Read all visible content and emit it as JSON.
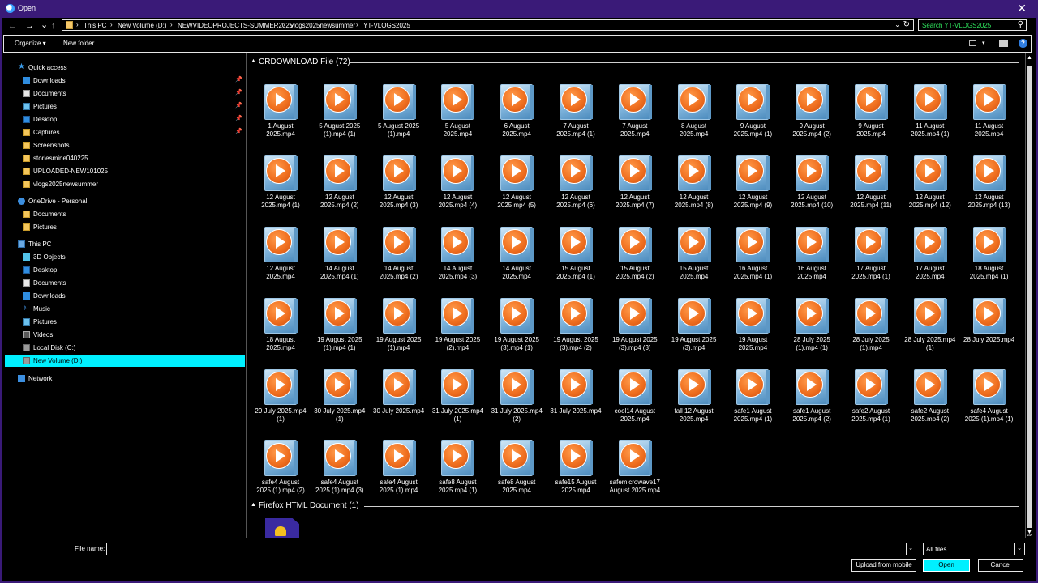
{
  "window": {
    "title": "Open",
    "close_glyph": "✕"
  },
  "nav_buttons": {
    "back": "←",
    "forward": "→",
    "recent": "⌄",
    "up": "↑"
  },
  "breadcrumb": [
    "This PC",
    "New Volume (D:)",
    "NEWVIDEOPROJECTS-SUMMER2025",
    "vlogs2025newsummer",
    "YT-VLOGS2025"
  ],
  "search": {
    "placeholder": "Search YT-VLOGS2025"
  },
  "toolbar": {
    "organize": "Organize ▾",
    "new_folder": "New folder",
    "help": "?"
  },
  "sidebar": {
    "quick_access": "Quick access",
    "quick_items": [
      {
        "label": "Downloads",
        "icon": "download-icon",
        "pinned": true
      },
      {
        "label": "Documents",
        "icon": "documents-icon",
        "pinned": true
      },
      {
        "label": "Pictures",
        "icon": "pictures-icon",
        "pinned": true
      },
      {
        "label": "Desktop",
        "icon": "desktop-icon",
        "pinned": true
      },
      {
        "label": "Captures",
        "icon": "folder-icon",
        "pinned": true
      },
      {
        "label": "Screenshots",
        "icon": "folder-icon",
        "pinned": false
      },
      {
        "label": "storiesmine040225",
        "icon": "folder-icon",
        "pinned": false
      },
      {
        "label": "UPLOADED-NEW101025",
        "icon": "folder-icon",
        "pinned": false
      },
      {
        "label": "vlogs2025newsummer",
        "icon": "folder-icon",
        "pinned": false
      }
    ],
    "onedrive": "OneDrive - Personal",
    "onedrive_items": [
      "Documents",
      "Pictures"
    ],
    "this_pc": "This PC",
    "pc_items": [
      "3D Objects",
      "Desktop",
      "Documents",
      "Downloads",
      "Music",
      "Pictures",
      "Videos",
      "Local Disk (C:)",
      "New Volume (D:)"
    ],
    "network": "Network",
    "selected": "New Volume (D:)"
  },
  "groups": {
    "crdownload": {
      "label": "CRDOWNLOAD File (72)"
    },
    "firefox": {
      "label": "Firefox HTML Document (1)"
    }
  },
  "files": [
    "1 August\n2025.mp4",
    "5 August 2025\n(1).mp4 (1)",
    "5 August 2025\n(1).mp4",
    "5 August\n2025.mp4",
    "6 August\n2025.mp4",
    "7 August\n2025.mp4 (1)",
    "7 August\n2025.mp4",
    "8 August\n2025.mp4",
    "9 August\n2025.mp4 (1)",
    "9 August\n2025.mp4 (2)",
    "9 August\n2025.mp4",
    "11 August\n2025.mp4 (1)",
    "11 August\n2025.mp4",
    "12 August\n2025.mp4 (1)",
    "12 August\n2025.mp4 (2)",
    "12 August\n2025.mp4 (3)",
    "12 August\n2025.mp4 (4)",
    "12 August\n2025.mp4 (5)",
    "12 August\n2025.mp4 (6)",
    "12 August\n2025.mp4 (7)",
    "12 August\n2025.mp4 (8)",
    "12 August\n2025.mp4 (9)",
    "12 August\n2025.mp4 (10)",
    "12 August\n2025.mp4 (11)",
    "12 August\n2025.mp4 (12)",
    "12 August\n2025.mp4 (13)",
    "12 August\n2025.mp4",
    "14 August\n2025.mp4 (1)",
    "14 August\n2025.mp4 (2)",
    "14 August\n2025.mp4 (3)",
    "14 August\n2025.mp4",
    "15 August\n2025.mp4 (1)",
    "15 August\n2025.mp4 (2)",
    "15 August\n2025.mp4",
    "16 August\n2025.mp4 (1)",
    "16 August\n2025.mp4",
    "17 August\n2025.mp4 (1)",
    "17 August\n2025.mp4",
    "18 August\n2025.mp4 (1)",
    "18 August\n2025.mp4",
    "19 August 2025\n(1).mp4 (1)",
    "19 August 2025\n(1).mp4",
    "19 August 2025\n(2).mp4",
    "19 August 2025\n(3).mp4 (1)",
    "19 August 2025\n(3).mp4 (2)",
    "19 August 2025\n(3).mp4 (3)",
    "19 August 2025\n(3).mp4",
    "19 August\n2025.mp4",
    "28 July 2025\n(1).mp4 (1)",
    "28 July 2025\n(1).mp4",
    "28 July 2025.mp4\n(1)",
    "28 July 2025.mp4",
    "29 July 2025.mp4\n(1)",
    "30 July 2025.mp4\n(1)",
    "30 July 2025.mp4",
    "31 July 2025.mp4\n(1)",
    "31 July 2025.mp4\n(2)",
    "31 July 2025.mp4",
    "cool14 August\n2025.mp4",
    "fall 12 August\n2025.mp4",
    "safe1 August\n2025.mp4 (1)",
    "safe1 August\n2025.mp4 (2)",
    "safe2 August\n2025.mp4 (1)",
    "safe2 August\n2025.mp4 (2)",
    "safe4 August\n2025 (1).mp4 (1)",
    "safe4 August\n2025 (1).mp4 (2)",
    "safe4 August\n2025 (1).mp4 (3)",
    "safe4 August\n2025 (1).mp4",
    "safe8 August\n2025.mp4 (1)",
    "safe8 August\n2025.mp4",
    "safe15 August\n2025.mp4",
    "safemicrowave17\nAugust 2025.mp4"
  ],
  "footer": {
    "file_name_label": "File name:",
    "file_name_value": "",
    "file_type": "All files",
    "upload_button": "Upload from mobile",
    "open_button": "Open",
    "cancel_button": "Cancel"
  },
  "colors": {
    "titlebar": "#3a1a78",
    "accent_selection": "#00f0ff",
    "search_text": "#2fe85e"
  }
}
